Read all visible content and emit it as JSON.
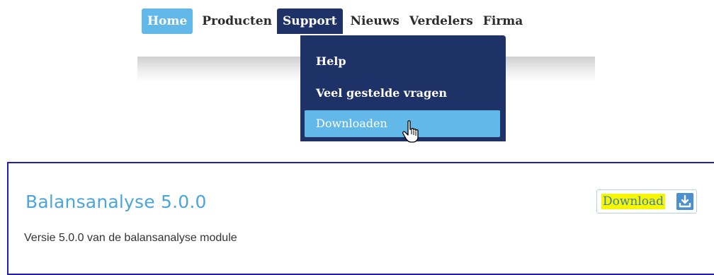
{
  "nav": {
    "items": [
      {
        "label": "Home",
        "state": "current"
      },
      {
        "label": "Producten"
      },
      {
        "label": "Support",
        "state": "open"
      },
      {
        "label": "Nieuws"
      },
      {
        "label": "Verdelers"
      },
      {
        "label": "Firma"
      }
    ]
  },
  "dropdown": {
    "items": [
      {
        "label": "Help"
      },
      {
        "label": "Veel gestelde vragen"
      },
      {
        "label": "Downloaden",
        "state": "hover"
      }
    ]
  },
  "content": {
    "title": "Balansanalyse 5.0.0",
    "description": "Versie 5.0.0 van de balansanalyse module",
    "download_label": "Download",
    "download_icon": "download-icon"
  },
  "colors": {
    "nav_active": "#62b8e8",
    "nav_dark": "#1f3268",
    "title": "#4aa6db",
    "highlight": "#f6f600"
  }
}
